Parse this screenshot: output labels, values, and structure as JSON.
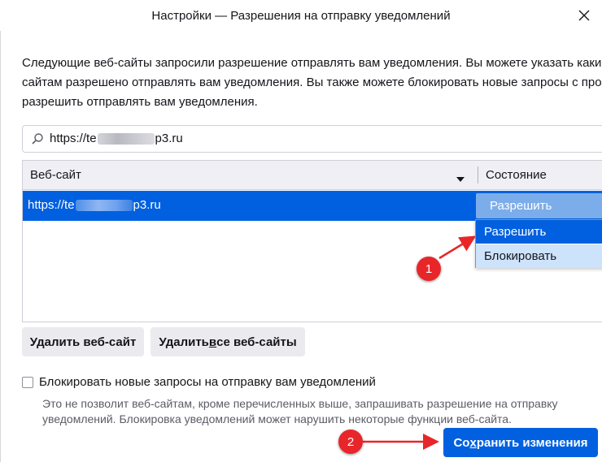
{
  "window": {
    "title": "Настройки — Разрешения на отправку уведомлений"
  },
  "description": [
    "Следующие веб-сайты запросили разрешение отправлять вам уведомления. Вы можете указать каким",
    "сайтам разрешено отправлять вам уведомления. Вы также можете блокировать новые запросы с просьбой",
    "разрешить отправлять вам уведомления."
  ],
  "search": {
    "value_prefix": "https://te",
    "value_suffix": "p3.ru"
  },
  "table": {
    "col_website": "Веб-сайт",
    "col_status": "Состояние",
    "rows": [
      {
        "url_prefix": "https://te",
        "url_suffix": "p3.ru",
        "status": "Разрешить"
      }
    ]
  },
  "dropdown": {
    "options": [
      "Разрешить",
      "Блокировать"
    ]
  },
  "buttons": {
    "remove_site": "Удалить веб-сайт",
    "remove_all_pre": "Удалить ",
    "remove_all_ul": "в",
    "remove_all_post": "се веб-сайты",
    "save_pre": "Со",
    "save_ul": "х",
    "save_post": "ранить изменения"
  },
  "block_new": {
    "label": "Блокировать новые запросы на отправку вам уведомлений",
    "note": [
      "Это не позволит веб-сайтам, кроме перечисленных выше, запрашивать разрешение на отправку",
      "уведомлений. Блокировка уведомлений может нарушить некоторые функции веб-сайта."
    ]
  },
  "annotations": {
    "badge1": "1",
    "badge2": "2"
  },
  "colors": {
    "accent": "#0060df",
    "annotation": "#e8262a",
    "button_bg": "#ebebef"
  }
}
